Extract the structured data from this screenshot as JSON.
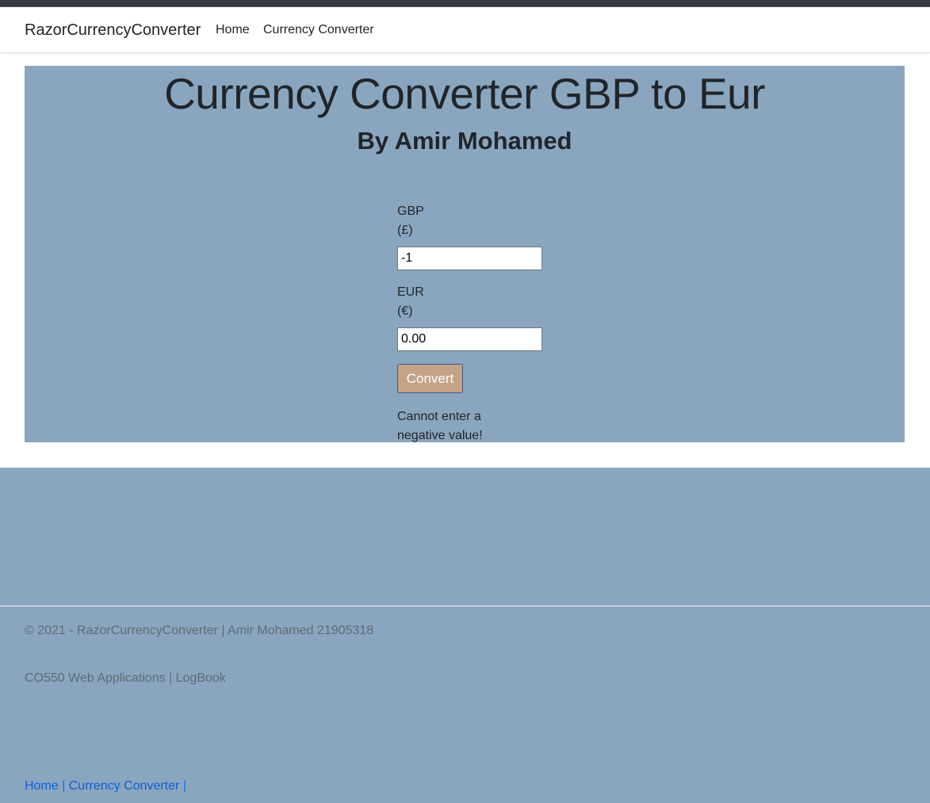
{
  "navbar": {
    "brand": "RazorCurrencyConverter",
    "links": [
      "Home",
      "Currency Converter"
    ]
  },
  "main": {
    "title": "Currency Converter GBP to Eur",
    "subtitle": "By Amir Mohamed",
    "gbp_label_line1": "GBP",
    "gbp_label_line2": "(£)",
    "gbp_value": "-1",
    "eur_label_line1": "EUR",
    "eur_label_line2": "(€)",
    "eur_value": "0.00",
    "convert_label": "Convert",
    "message": "Cannot enter a negative value!"
  },
  "footer": {
    "copyright": "© 2021 - RazorCurrencyConverter | Amir Mohamed 21905318",
    "course": "CO550 Web Applications | LogBook",
    "link_home": "Home",
    "link_converter": "Currency Converter"
  },
  "colors": {
    "panel_bg": "#8aa6bf",
    "button_bg": "#c4a387",
    "link": "#0b5ed7"
  }
}
